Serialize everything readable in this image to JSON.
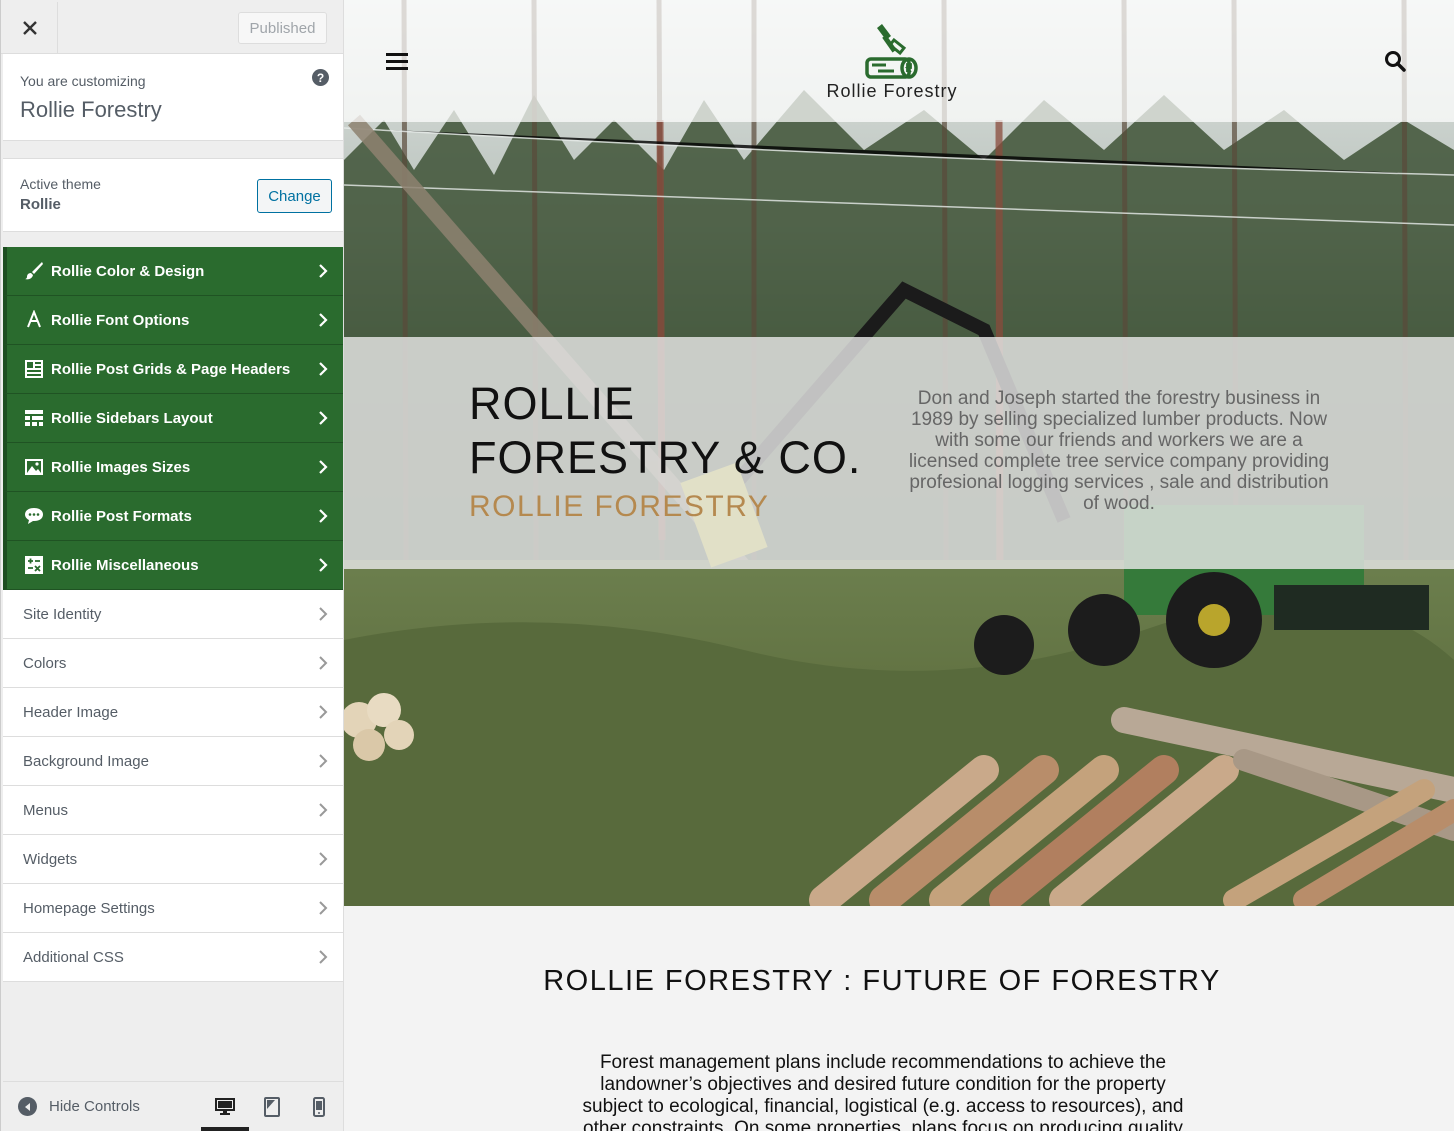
{
  "sidebar": {
    "published_label": "Published",
    "customizing_label": "You are customizing",
    "site_name": "Rollie Forestry",
    "active_theme_label": "Active theme",
    "theme_name": "Rollie",
    "change_label": "Change",
    "theme_sections": [
      {
        "label": "Rollie Color & Design",
        "icon": "brush-icon"
      },
      {
        "label": "Rollie Font Options",
        "icon": "font-icon"
      },
      {
        "label": "Rollie Post Grids & Page Headers",
        "icon": "grid-layout-icon"
      },
      {
        "label": "Rollie Sidebars Layout",
        "icon": "sidebar-layout-icon"
      },
      {
        "label": "Rollie Images Sizes",
        "icon": "image-icon"
      },
      {
        "label": "Rollie Post Formats",
        "icon": "chat-bubble-icon"
      },
      {
        "label": "Rollie Miscellaneous",
        "icon": "misc-icon"
      }
    ],
    "core_sections": [
      {
        "label": "Site Identity"
      },
      {
        "label": "Colors"
      },
      {
        "label": "Header Image"
      },
      {
        "label": "Background Image"
      },
      {
        "label": "Menus"
      },
      {
        "label": "Widgets"
      },
      {
        "label": "Homepage Settings"
      },
      {
        "label": "Additional CSS"
      }
    ],
    "hide_controls_label": "Hide Controls",
    "devices": [
      "desktop-icon",
      "tablet-icon",
      "mobile-icon"
    ],
    "accent_color": "#2a6b2e"
  },
  "preview": {
    "site_title": "Rollie Forestry",
    "hero_heading": "ROLLIE FORESTRY & CO.",
    "hero_tagline": "ROLLIE FORESTRY",
    "hero_text": "Don and Joseph started the forestry business in 1989 by selling specialized lumber products. Now with some our friends and workers we are a licensed complete tree service company providing profesional logging services , sale and distribution of wood.",
    "section_heading": "ROLLIE FORESTRY : FUTURE OF FORESTRY",
    "section_text": "Forest management plans include recommendations to achieve the landowner’s objectives and desired future condition for the property subject to ecological, financial, logistical (e.g. access to resources), and other constraints. On some properties, plans focus on producing quality wood",
    "tagline_color": "#b5894f"
  }
}
